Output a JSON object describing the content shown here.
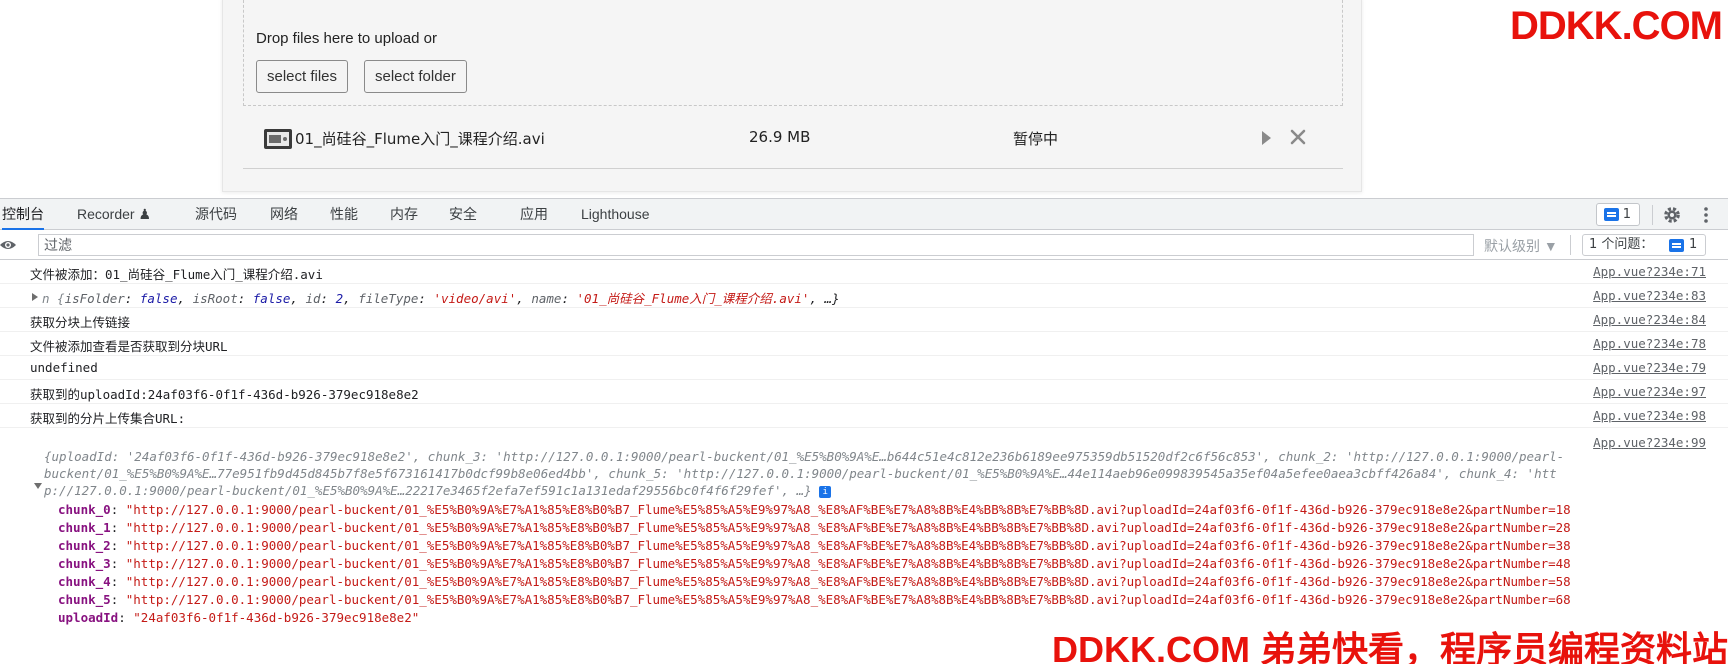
{
  "uploader": {
    "drop_text": "Drop files here to upload or",
    "select_files_label": "select files",
    "select_folder_label": "select folder",
    "file": {
      "name": "01_尚硅谷_Flume入门_课程介绍.avi",
      "size": "26.9 MB",
      "status": "暂停中"
    }
  },
  "watermark": {
    "top": "DDKK.COM",
    "bottom": "DDKK.COM 弟弟快看，程序员编程资料站",
    "color": "#e8120c"
  },
  "devtools": {
    "tabs": [
      {
        "label": "控制台",
        "active": true
      },
      {
        "label": "Recorder ♟"
      },
      {
        "label": "源代码"
      },
      {
        "label": "网络"
      },
      {
        "label": "性能"
      },
      {
        "label": "内存"
      },
      {
        "label": "安全"
      },
      {
        "label": "应用"
      },
      {
        "label": "Lighthouse"
      }
    ],
    "issues_badge": "1",
    "filter_placeholder": "过滤",
    "level_label": "默认级别 ▼",
    "issues_count_label": "1 个问题：",
    "issues_count_value": "1",
    "accent": "#1a73e8"
  },
  "console": {
    "rows": [
      {
        "text": "文件被添加：01_尚硅谷_Flume入门_课程介绍.avi",
        "source": "App.vue?234e:71"
      },
      {
        "text": "n {isFolder: false, isRoot: false, id: 2, fileType: 'video/avi', name: '01_尚硅谷_Flume入门_课程介绍.avi', …}",
        "source": "App.vue?234e:83"
      },
      {
        "text": "获取分块上传链接",
        "source": "App.vue?234e:84"
      },
      {
        "text": "文件被添加查看是否获取到分块URL",
        "source": "App.vue?234e:78"
      },
      {
        "text": "undefined",
        "source": "App.vue?234e:79"
      },
      {
        "text": "获取到的uploadId:24af03f6-0f1f-436d-b926-379ec918e8e2",
        "source": "App.vue?234e:97"
      },
      {
        "text": "获取到的分片上传集合URL:",
        "source": "App.vue?234e:98"
      },
      {
        "text": "",
        "source": "App.vue?234e:99"
      }
    ],
    "object_preview": {
      "line1": "{uploadId: '24af03f6-0f1f-436d-b926-379ec918e8e2', chunk_3: 'http://127.0.0.1:9000/pearl-buckent/01_%E5%B0%9A%E…b644c51e4c812e236b6189ee975359db51520df2c6f56c853', chunk_2: 'http://127.0.0.1:9000/pearl-",
      "line2": "buckent/01_%E5%B0%9A%E…77e951fb9d45d845b7f8e5f673161417b0dcf99b8e06ed4bb', chunk_5: 'http://127.0.0.1:9000/pearl-buckent/01_%E5%B0%9A%E…44e114aeb96e099839545a35ef04a5efee0aea3cbff426a84', chunk_4: 'htt",
      "line3": "p://127.0.0.1:9000/pearl-buckent/01_%E5%B0%9A%E…22217e3465f2efa7ef591c1a131edaf29556bc0f4f6f29fef', …}",
      "info": "i"
    },
    "props": [
      {
        "key": "chunk_0",
        "value": "\"http://127.0.0.1:9000/pearl-buckent/01_%E5%B0%9A%E7%A1%85%E8%B0%B7_Flume%E5%85%A5%E9%97%A8_%E8%AF%BE%E7%A8%8B%E4%BB%8B%E7%BB%8D.avi?uploadId=24af03f6-0f1f-436d-b926-379ec918e8e2&partNumber=18"
      },
      {
        "key": "chunk_1",
        "value": "\"http://127.0.0.1:9000/pearl-buckent/01_%E5%B0%9A%E7%A1%85%E8%B0%B7_Flume%E5%85%A5%E9%97%A8_%E8%AF%BE%E7%A8%8B%E4%BB%8B%E7%BB%8D.avi?uploadId=24af03f6-0f1f-436d-b926-379ec918e8e2&partNumber=28"
      },
      {
        "key": "chunk_2",
        "value": "\"http://127.0.0.1:9000/pearl-buckent/01_%E5%B0%9A%E7%A1%85%E8%B0%B7_Flume%E5%85%A5%E9%97%A8_%E8%AF%BE%E7%A8%8B%E4%BB%8B%E7%BB%8D.avi?uploadId=24af03f6-0f1f-436d-b926-379ec918e8e2&partNumber=38"
      },
      {
        "key": "chunk_3",
        "value": "\"http://127.0.0.1:9000/pearl-buckent/01_%E5%B0%9A%E7%A1%85%E8%B0%B7_Flume%E5%85%A5%E9%97%A8_%E8%AF%BE%E7%A8%8B%E4%BB%8B%E7%BB%8D.avi?uploadId=24af03f6-0f1f-436d-b926-379ec918e8e2&partNumber=48"
      },
      {
        "key": "chunk_4",
        "value": "\"http://127.0.0.1:9000/pearl-buckent/01_%E5%B0%9A%E7%A1%85%E8%B0%B7_Flume%E5%85%A5%E9%97%A8_%E8%AF%BE%E7%A8%8B%E4%BB%8B%E7%BB%8D.avi?uploadId=24af03f6-0f1f-436d-b926-379ec918e8e2&partNumber=58"
      },
      {
        "key": "chunk_5",
        "value": "\"http://127.0.0.1:9000/pearl-buckent/01_%E5%B0%9A%E7%A1%85%E8%B0%B7_Flume%E5%85%A5%E9%97%A8_%E8%AF%BE%E7%A8%8B%E4%BB%8B%E7%BB%8D.avi?uploadId=24af03f6-0f1f-436d-b926-379ec918e8e2&partNumber=68"
      },
      {
        "key": "uploadId",
        "value": "\"24af03f6-0f1f-436d-b926-379ec918e8e2\""
      }
    ]
  }
}
